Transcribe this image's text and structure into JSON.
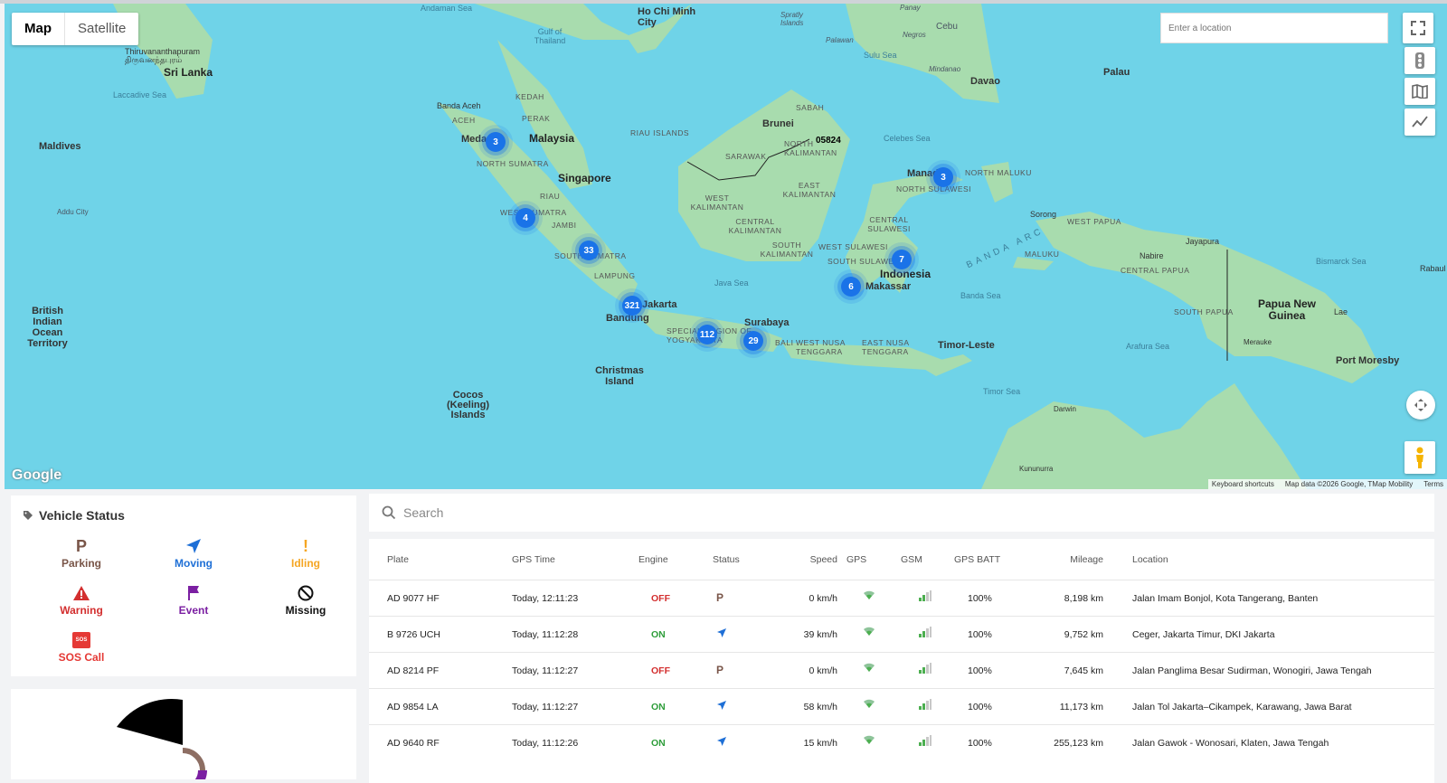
{
  "map": {
    "type_buttons": [
      "Map",
      "Satellite"
    ],
    "location_placeholder": "Enter a location",
    "google_logo": "Google",
    "attribution": [
      "Keyboard shortcuts",
      "Map data ©2026 Google, TMap Mobility",
      "Terms"
    ],
    "labels": {
      "andaman": "Andaman Sea",
      "hcm": "Ho Chi Minh City",
      "spratly": "Spratly Islands",
      "panay": "Panay",
      "cebu": "Cebu",
      "negros": "Negros",
      "palawan": "Palawan",
      "gulf_thailand": "Gulf of Thailand",
      "thiruv": "Thiruvananthapuram",
      "thiruv_local": "திருவனந்தபுரம்",
      "srilanka": "Sri Lanka",
      "laccadive": "Laccadive Sea",
      "maldives": "Maldives",
      "addu": "Addu City",
      "banda_aceh": "Banda Aceh",
      "aceh": "ACEH",
      "kedah": "KEDAH",
      "perak": "PERAK",
      "medan": "Medan",
      "malaysia": "Malaysia",
      "riau_islands": "RIAU ISLANDS",
      "north_sumatra": "NORTH SUMATRA",
      "singapore": "Singapore",
      "riau": "RIAU",
      "west_sumatra": "WEST SUMATRA",
      "jambi": "JAMBI",
      "south_sumatra": "SOUTH SUMATRA",
      "lampung": "LAMPUNG",
      "jakarta": "Jakarta",
      "bandung": "Bandung",
      "special_region": "SPECIAL REGION OF YOGYAKARTA",
      "surabaya": "Surabaya",
      "bali": "BALI",
      "west_nusa": "WEST NUSA TENGGARA",
      "east_nusa": "EAST NUSA TENGGARA",
      "christmas": "Christmas Island",
      "cocos": "Cocos (Keeling) Islands",
      "british": "British Indian Ocean Territory",
      "sulu": "Sulu Sea",
      "mindanao": "Mindanao",
      "davao": "Davao",
      "palau": "Palau",
      "sabah": "SABAH",
      "brunei": "Brunei",
      "north_kal": "NORTH KALIMANTAN",
      "sarawak": "SARAWAK",
      "celebes": "Celebes Sea",
      "east_kal": "EAST KALIMANTAN",
      "west_kal": "WEST KALIMANTAN",
      "central_kal": "CENTRAL KALIMANTAN",
      "south_kal": "SOUTH KALIMANTAN",
      "java_sea": "Java Sea",
      "manado": "Manado",
      "north_maluku": "NORTH MALUKU",
      "north_sulawesi": "NORTH SULAWESI",
      "central_sulawesi": "CENTRAL SULAWESI",
      "west_sulawesi": "WEST SULAWESI",
      "south_sulawesi": "SOUTH SULAWESI",
      "indonesia": "Indonesia",
      "makassar": "Makassar",
      "banda_arc": "BANDA ARC",
      "banda_sea": "Banda Sea",
      "maluku": "MALUKU",
      "sorong": "Sorong",
      "west_papua": "WEST PAPUA",
      "nabire": "Nabire",
      "central_papua": "CENTRAL PAPUA",
      "jayapura": "Jayapura",
      "south_papua": "SOUTH PAPUA",
      "png": "Papua New Guinea",
      "lae": "Lae",
      "bismarck": "Bismarck Sea",
      "rabaul": "Rabaul",
      "timor_leste": "Timor-Leste",
      "arafura": "Arafura Sea",
      "merauke": "Merauke",
      "port_moresby": "Port Moresby",
      "timor_sea": "Timor Sea",
      "darwin": "Darwin",
      "kununurra": "Kununurra",
      "vehicle_marker": "05824"
    },
    "clusters": [
      "3",
      "4",
      "33",
      "321",
      "112",
      "29",
      "6",
      "7",
      "3"
    ]
  },
  "vehicle_status": {
    "title": "Vehicle Status",
    "items": [
      {
        "label": "Parking",
        "color": "#795548",
        "icon": "parking-icon"
      },
      {
        "label": "Moving",
        "color": "#1e6fd6",
        "icon": "navigation-arrow-icon"
      },
      {
        "label": "Idling",
        "color": "#f5a623",
        "icon": "exclamation-icon"
      },
      {
        "label": "Warning",
        "color": "#d32f2f",
        "icon": "warning-triangle-icon"
      },
      {
        "label": "Event",
        "color": "#7b1fa2",
        "icon": "flag-icon"
      },
      {
        "label": "Missing",
        "color": "#111111",
        "icon": "no-entry-icon"
      },
      {
        "label": "SOS Call",
        "color": "#e53935",
        "icon": "sos-icon"
      }
    ],
    "sos_icon_text": "SOS"
  },
  "search": {
    "placeholder": "Search"
  },
  "table": {
    "headers": [
      "Plate",
      "GPS Time",
      "Engine",
      "Status",
      "Speed",
      "GPS",
      "GSM",
      "GPS BATT",
      "Mileage",
      "Location"
    ],
    "rows": [
      {
        "plate": "AD 9077 HF",
        "time": "Today, 12:11:23",
        "engine": "OFF",
        "status": "parking",
        "speed": "0 km/h",
        "batt": "100%",
        "mileage": "8,198 km",
        "location": "Jalan Imam Bonjol, Kota Tangerang, Banten"
      },
      {
        "plate": "B 9726 UCH",
        "time": "Today, 11:12:28",
        "engine": "ON",
        "status": "moving",
        "speed": "39 km/h",
        "batt": "100%",
        "mileage": "9,752 km",
        "location": "Ceger, Jakarta Timur, DKI Jakarta"
      },
      {
        "plate": "AD 8214 PF",
        "time": "Today, 11:12:27",
        "engine": "OFF",
        "status": "parking",
        "speed": "0 km/h",
        "batt": "100%",
        "mileage": "7,645 km",
        "location": "Jalan Panglima Besar Sudirman, Wonogiri, Jawa Tengah"
      },
      {
        "plate": "AD 9854 LA",
        "time": "Today, 11:12:27",
        "engine": "ON",
        "status": "moving",
        "speed": "58 km/h",
        "batt": "100%",
        "mileage": "11,173 km",
        "location": "Jalan Tol Jakarta–Cikampek, Karawang, Jawa Barat"
      },
      {
        "plate": "AD 9640 RF",
        "time": "Today, 11:12:26",
        "engine": "ON",
        "status": "moving",
        "speed": "15 km/h",
        "batt": "100%",
        "mileage": "255,123 km",
        "location": "Jalan Gawok - Wonosari, Klaten, Jawa Tengah"
      }
    ]
  }
}
